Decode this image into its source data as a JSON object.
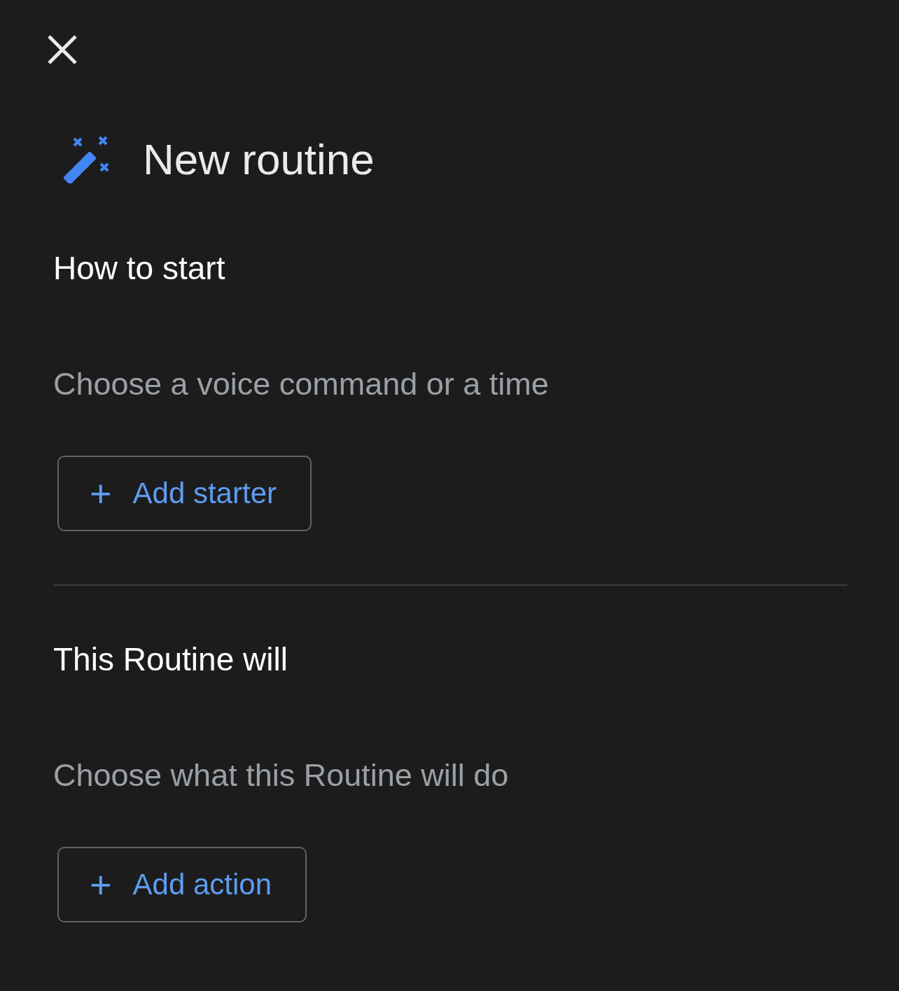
{
  "title": "New routine",
  "sections": [
    {
      "heading": "How to start",
      "description": "Choose a voice command or a time",
      "button": {
        "icon": "+",
        "label": "Add starter"
      }
    },
    {
      "heading": "This Routine will",
      "description": "Choose what this Routine will do",
      "button": {
        "icon": "+",
        "label": "Add action"
      }
    }
  ]
}
